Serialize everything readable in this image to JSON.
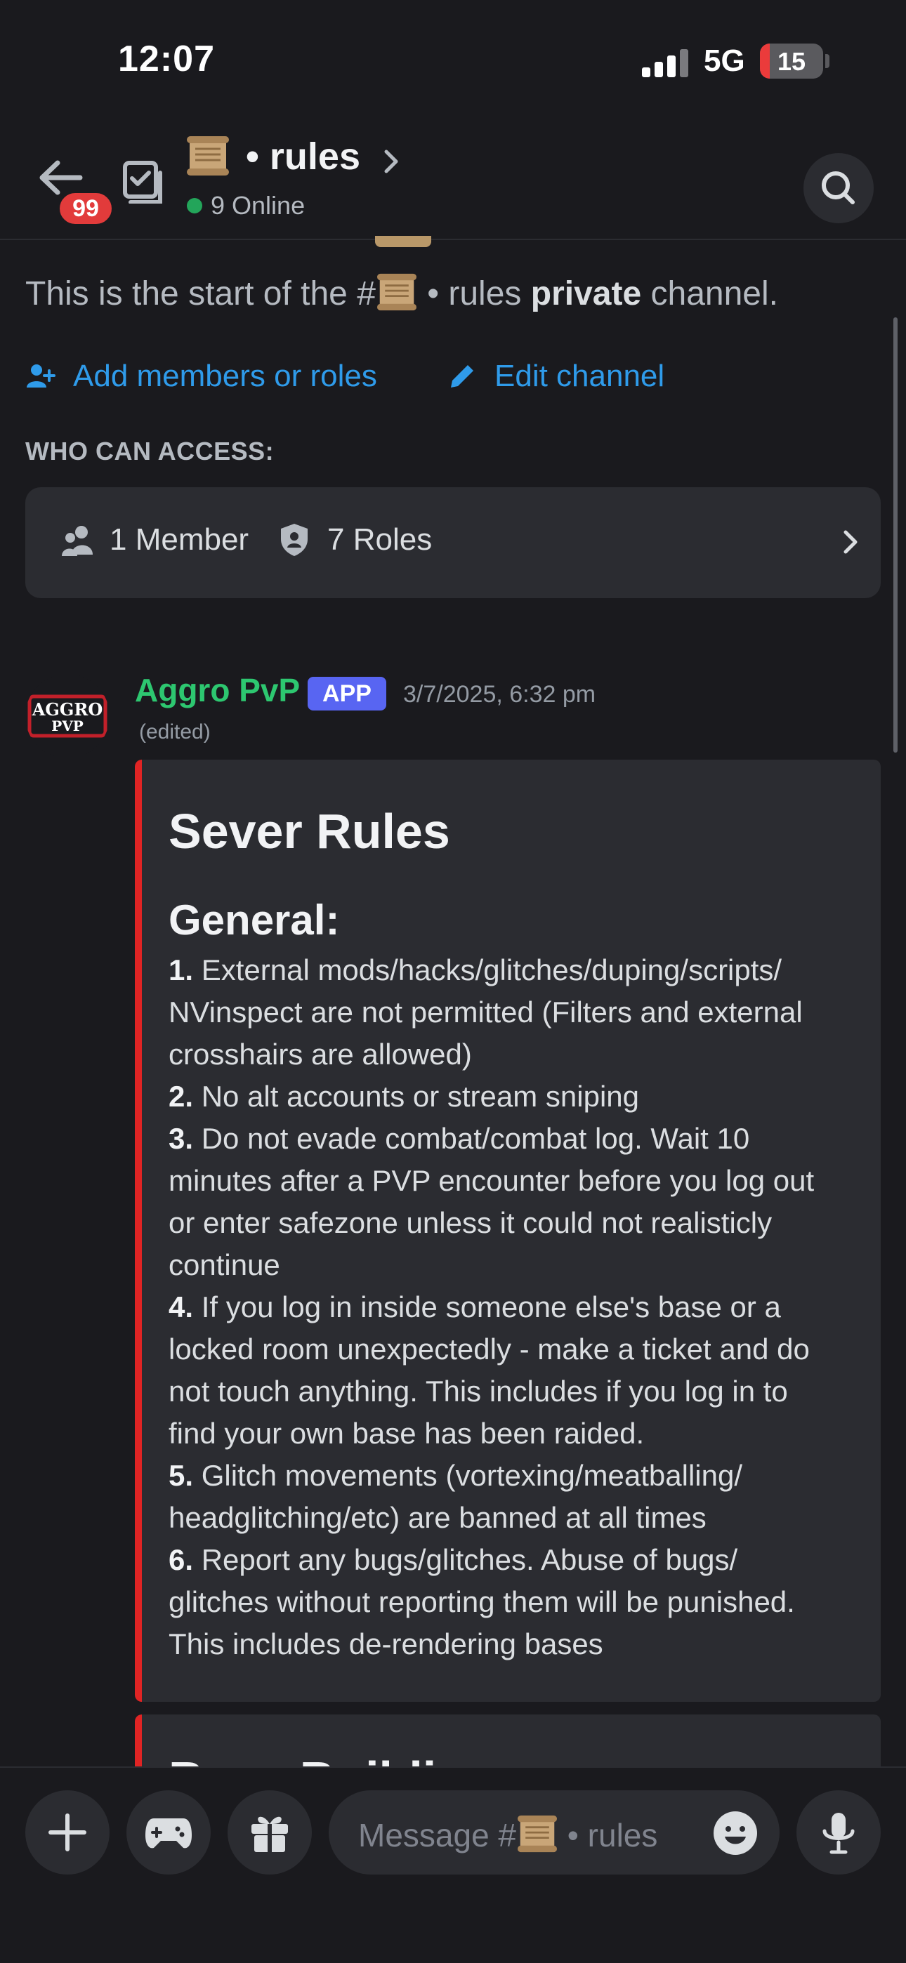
{
  "status_bar": {
    "time": "12:07",
    "network": "5G",
    "battery": "15",
    "battery_level": 0.15,
    "battery_color": "#eb3b3b"
  },
  "header": {
    "unread_badge": "99",
    "channel_name": "• rules",
    "channel_icon": "scroll-icon",
    "online_count": "9 Online"
  },
  "intro": {
    "prefix": "This is the start of the #",
    "channel": " • rules ",
    "privacy": "private",
    "suffix": " channel."
  },
  "actions": {
    "add_members": "Add members or roles",
    "edit_channel": "Edit channel"
  },
  "access": {
    "label": "WHO CAN ACCESS:",
    "members": "1 Member",
    "roles": "7 Roles"
  },
  "message": {
    "author": "Aggro PvP",
    "tag": "APP",
    "timestamp": "3/7/2025, 6:32 pm",
    "edited": "(edited)",
    "avatar_text": [
      "AGGRO",
      "PVP"
    ],
    "author_color": "#2dc770"
  },
  "embed": {
    "accent_color": "#e02424",
    "title": "Sever Rules",
    "section": "General:",
    "lines": [
      {
        "num": "1.",
        "text": " External mods/hacks/glitches/duping/scripts/"
      },
      {
        "num": "",
        "text": "NVinspect are not permitted (Filters and external"
      },
      {
        "num": "",
        "text": "crosshairs are allowed)"
      },
      {
        "num": "2.",
        "text": " No alt accounts or stream sniping"
      },
      {
        "num": "3.",
        "text": " Do not evade combat/combat log. Wait 10"
      },
      {
        "num": "",
        "text": "minutes after a PVP encounter before you log out"
      },
      {
        "num": "",
        "text": "or enter safezone unless it could not realisticly"
      },
      {
        "num": "",
        "text": "continue"
      },
      {
        "num": "4.",
        "text": " If you log in inside someone else's base or a"
      },
      {
        "num": "",
        "text": "locked room unexpectedly - make a ticket and do"
      },
      {
        "num": "",
        "text": "not touch anything. This includes if you log in to"
      },
      {
        "num": "",
        "text": "find your own base has been raided."
      },
      {
        "num": "5.",
        "text": " Glitch movements (vortexing/meatballing/"
      },
      {
        "num": "",
        "text": "headglitching/etc) are banned at all times"
      },
      {
        "num": "6.",
        "text": " Report any bugs/glitches. Abuse of bugs/"
      },
      {
        "num": "",
        "text": "glitches without reporting them will be punished."
      },
      {
        "num": "",
        "text": "This includes de-rendering bases"
      }
    ]
  },
  "next_embed_peek": "Base Buildi",
  "composer": {
    "placeholder_prefix": "Message #",
    "placeholder_channel": " • rules"
  }
}
